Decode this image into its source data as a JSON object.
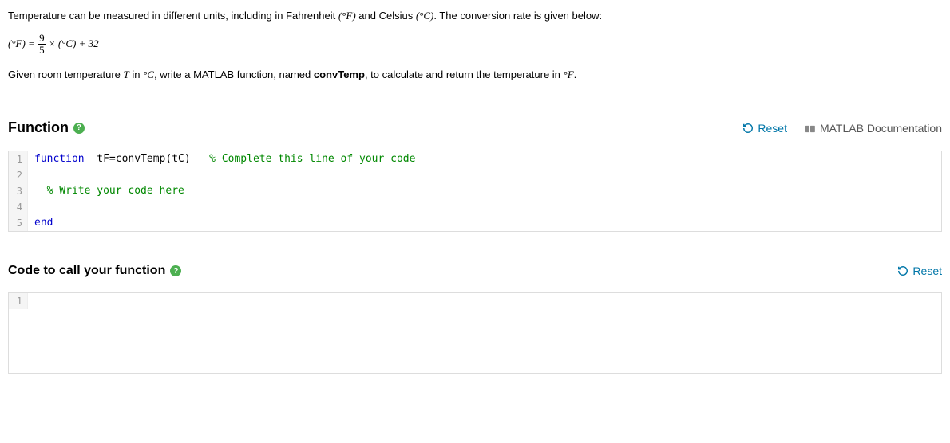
{
  "problem": {
    "line1_pre": "Temperature can be measured in different units, including in Fahrenheit ",
    "unit_f": "(°F)",
    "line1_mid": " and Celsius ",
    "unit_c": "(°C)",
    "line1_post": ". The conversion rate is given below:",
    "formula_lhs": "(°F) = ",
    "formula_frac_num": "9",
    "formula_frac_den": "5",
    "formula_rhs": " × (°C) + 32",
    "line2_pre": "Given room temperature ",
    "var_T": "T",
    "line2_mid1": " in ",
    "unit_c2": "°C",
    "line2_mid2": ", write a MATLAB function, named ",
    "func_name": "convTemp",
    "line2_mid3": ", to calculate and return the temperature in ",
    "unit_f2": "°F",
    "line2_end": "."
  },
  "function_section": {
    "title": "Function",
    "reset": "Reset",
    "doc_link": "MATLAB Documentation",
    "code": {
      "l1_kw": "function",
      "l1_rest": "  tF=convTemp(tC)   ",
      "l1_comment": "% Complete this line of your code",
      "l2": "",
      "l3_indent": "  ",
      "l3_comment": "% Write your code here",
      "l4": "",
      "l5_kw": "end"
    },
    "line_nums": {
      "n1": "1",
      "n2": "2",
      "n3": "3",
      "n4": "4",
      "n5": "5"
    }
  },
  "call_section": {
    "title": "Code to call your function",
    "reset": "Reset",
    "line_nums": {
      "n1": "1"
    },
    "code": {
      "l1": ""
    }
  }
}
